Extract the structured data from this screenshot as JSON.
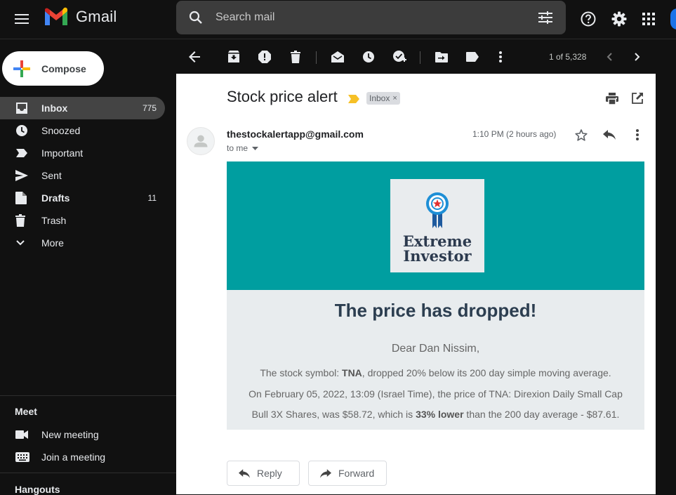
{
  "app": {
    "name": "Gmail"
  },
  "search": {
    "placeholder": "Search mail"
  },
  "compose": {
    "label": "Compose"
  },
  "sidebar": {
    "items": [
      {
        "label": "Inbox",
        "count": "775"
      },
      {
        "label": "Snoozed",
        "count": ""
      },
      {
        "label": "Important",
        "count": ""
      },
      {
        "label": "Sent",
        "count": ""
      },
      {
        "label": "Drafts",
        "count": "11"
      },
      {
        "label": "Trash",
        "count": ""
      },
      {
        "label": "More",
        "count": ""
      }
    ],
    "meet": {
      "title": "Meet",
      "new_meeting": "New meeting",
      "join_meeting": "Join a meeting"
    },
    "hangouts": {
      "title": "Hangouts"
    }
  },
  "toolbar": {
    "pager": "1 of 5,328"
  },
  "email": {
    "subject": "Stock price alert",
    "label_chip": "Inbox",
    "label_chip_close": "×",
    "sender": "thestockalertapp@gmail.com",
    "to": "to me",
    "timestamp": "1:10 PM (2 hours ago)",
    "body": {
      "logo_line1": "Extreme",
      "logo_line2": "Investor",
      "heading": "The price has dropped!",
      "greeting": "Dear Dan Nissim,",
      "line1_pre": "The stock symbol: ",
      "line1_symbol": "TNA",
      "line1_post": ", dropped 20% below its 200 day simple moving average.",
      "line2": "On February 05, 2022, 13:09 (Israel Time), the price of TNA: Direxion Daily Small Cap",
      "line3_pre": "Bull 3X Shares, was $58.72, which is ",
      "line3_bold": "33% lower",
      "line3_post": " than the 200 day average - $87.61."
    }
  },
  "actions": {
    "reply": "Reply",
    "forward": "Forward"
  },
  "colors": {
    "banner": "#009ea0",
    "body_bg": "#e8ecee",
    "heading": "#2c3e50",
    "important_marker": "#f6c026",
    "sidebar_active": "#444444"
  }
}
